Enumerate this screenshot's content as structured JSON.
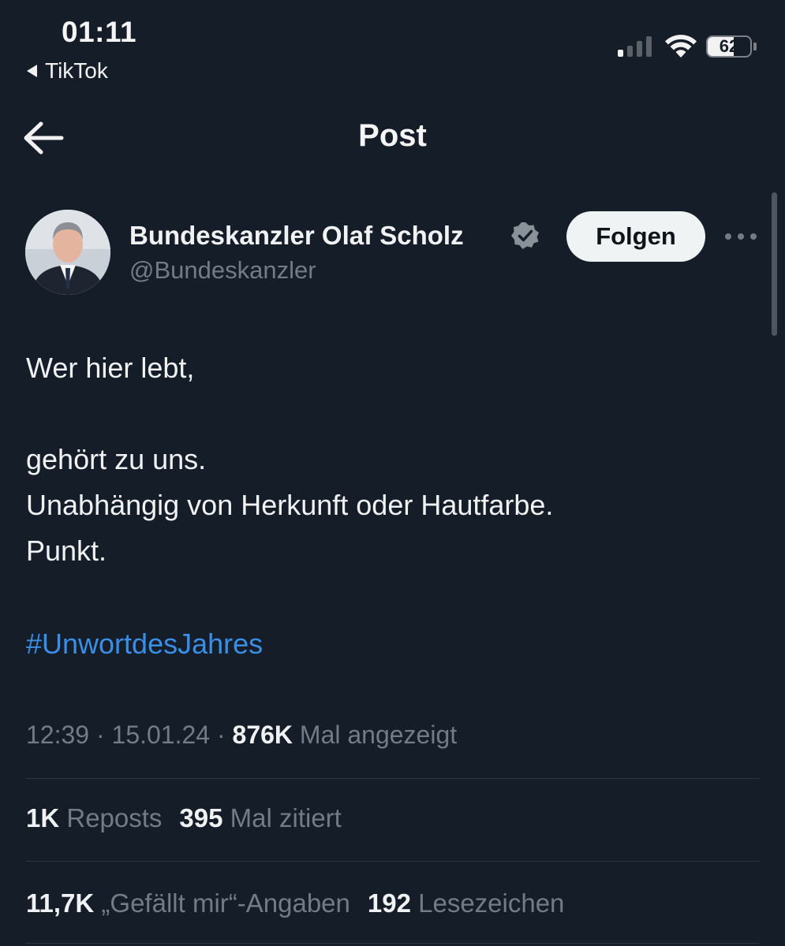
{
  "status_bar": {
    "time": "01:11",
    "back_app": "TikTok",
    "battery_level": "62",
    "battery_fraction": 0.62
  },
  "nav": {
    "title": "Post"
  },
  "author": {
    "name": "Bundeskanzler Olaf Scholz",
    "handle": "@Bundeskanzler",
    "follow_label": "Folgen"
  },
  "post": {
    "line1": "Wer hier lebt,",
    "line2": "gehört zu uns.",
    "line3": "Unabhängig von Herkunft oder Hautfarbe.",
    "line4": "Punkt.",
    "hashtag": "#UnwortdesJahres"
  },
  "meta": {
    "time": "12:39",
    "date": "15.01.24",
    "views": "876K",
    "views_label": "Mal angezeigt"
  },
  "stats": {
    "reposts": "1K",
    "reposts_label": "Reposts",
    "quotes": "395",
    "quotes_label": "Mal zitiert",
    "likes": "11,7K",
    "likes_label": "„Gefällt mir“-Angaben",
    "bookmarks": "192",
    "bookmarks_label": "Lesezeichen"
  },
  "colors": {
    "background": "#151d28",
    "link": "#3b8ee6",
    "secondary_text": "#737b86"
  }
}
